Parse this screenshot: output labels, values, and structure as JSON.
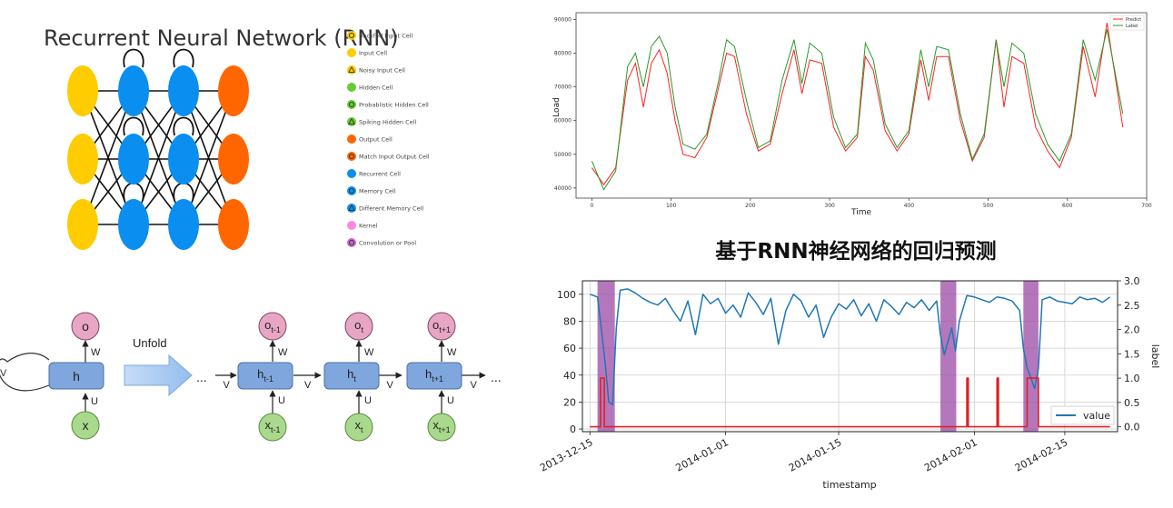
{
  "rnn_panel": {
    "title": "Recurrent Neural Network (RNN)",
    "legend": [
      {
        "label": "Backfed Input Cell",
        "color": "#ffcc00",
        "icon": "ring-dot"
      },
      {
        "label": "Input Cell",
        "color": "#ffcc00",
        "icon": "circle"
      },
      {
        "label": "Noisy Input Cell",
        "color": "#ffcc00",
        "icon": "triangle"
      },
      {
        "label": "Hidden Cell",
        "color": "#66cc33",
        "icon": "circle"
      },
      {
        "label": "Probablistic Hidden Cell",
        "color": "#66cc33",
        "icon": "ring-dot"
      },
      {
        "label": "Spiking Hidden Cell",
        "color": "#66cc33",
        "icon": "triangle"
      },
      {
        "label": "Output Cell",
        "color": "#ff6600",
        "icon": "circle"
      },
      {
        "label": "Match Input Output Cell",
        "color": "#ff6600",
        "icon": "ring-dot"
      },
      {
        "label": "Recurrent Cell",
        "color": "#0a8ef0",
        "icon": "circle"
      },
      {
        "label": "Memory Cell",
        "color": "#0a8ef0",
        "icon": "ring-dot"
      },
      {
        "label": "Different Memory Cell",
        "color": "#0a8ef0",
        "icon": "triangle"
      },
      {
        "label": "Kernel",
        "color": "#ff88dd",
        "icon": "circle"
      },
      {
        "label": "Convolution or Pool",
        "color": "#cc66cc",
        "icon": "ring-dot"
      }
    ],
    "colors": {
      "input": "#ffcc00",
      "recurrent": "#0a8ef0",
      "output": "#ff6600"
    }
  },
  "unfold_panel": {
    "unfold_label": "Unfold",
    "folded": {
      "o": "o",
      "h": "h",
      "x": "x",
      "w": "W",
      "u": "U",
      "v": "V"
    },
    "steps": [
      {
        "o": "o",
        "o_sub": "t-1",
        "h": "h",
        "h_sub": "t-1",
        "x": "x",
        "x_sub": "t-1"
      },
      {
        "o": "o",
        "o_sub": "t",
        "h": "h",
        "h_sub": "t",
        "x": "x",
        "x_sub": "t"
      },
      {
        "o": "o",
        "o_sub": "t+1",
        "h": "h",
        "h_sub": "t+1",
        "x": "x",
        "x_sub": "t+1"
      }
    ],
    "edge_labels": {
      "w": "W",
      "u": "U",
      "v": "V"
    },
    "ellipsis": "...",
    "colors": {
      "o": "#e8a6c4",
      "h": "#7fa7dd",
      "x": "#a9d98c",
      "arrow": "#aac8f2"
    }
  },
  "heading": "基于RNN神经网络的回归预测",
  "chart_data": [
    {
      "type": "line",
      "xlabel": "Time",
      "ylabel": "Load",
      "xlim": [
        -20,
        700
      ],
      "ylim": [
        37000,
        92000
      ],
      "xticks": [
        0,
        100,
        200,
        300,
        400,
        500,
        600,
        700
      ],
      "yticks": [
        40000,
        50000,
        60000,
        70000,
        80000,
        90000
      ],
      "legend_position": "top-right",
      "series": [
        {
          "name": "Predict",
          "color": "#ff2222",
          "x": [
            0,
            15,
            30,
            45,
            55,
            65,
            75,
            85,
            95,
            105,
            115,
            130,
            145,
            160,
            170,
            180,
            195,
            210,
            225,
            240,
            255,
            265,
            275,
            290,
            305,
            320,
            335,
            345,
            355,
            370,
            385,
            400,
            415,
            425,
            435,
            450,
            465,
            480,
            495,
            510,
            520,
            530,
            545,
            560,
            575,
            590,
            605,
            620,
            635,
            650,
            670
          ],
          "y": [
            46000,
            41000,
            46000,
            72000,
            77000,
            64000,
            77000,
            81000,
            74000,
            60000,
            50000,
            49000,
            55000,
            70000,
            80000,
            79000,
            62000,
            51000,
            53000,
            68000,
            81000,
            68000,
            78000,
            77000,
            58000,
            51000,
            55000,
            79000,
            75000,
            57000,
            51000,
            56000,
            78000,
            66000,
            79000,
            79000,
            60000,
            48000,
            55000,
            84000,
            64000,
            79000,
            77000,
            58000,
            51000,
            46000,
            55000,
            82000,
            67000,
            89000,
            58000
          ]
        },
        {
          "name": "Label",
          "color": "#2a9a2a",
          "x": [
            0,
            15,
            30,
            45,
            55,
            65,
            75,
            85,
            95,
            105,
            115,
            130,
            145,
            160,
            170,
            180,
            195,
            210,
            225,
            240,
            255,
            265,
            275,
            290,
            305,
            320,
            335,
            345,
            355,
            370,
            385,
            400,
            415,
            425,
            435,
            450,
            465,
            480,
            495,
            510,
            520,
            530,
            545,
            560,
            575,
            590,
            605,
            620,
            635,
            650,
            670
          ],
          "y": [
            48000,
            39500,
            45000,
            76000,
            80000,
            70000,
            82000,
            85000,
            80000,
            64000,
            53000,
            51500,
            56000,
            72000,
            84000,
            82000,
            66000,
            52000,
            54000,
            72000,
            84000,
            71000,
            83000,
            80000,
            61000,
            52000,
            56000,
            83000,
            78000,
            59000,
            52000,
            57000,
            81000,
            70000,
            82000,
            81000,
            62000,
            48500,
            56000,
            84000,
            70000,
            83000,
            80000,
            62000,
            53000,
            48000,
            56000,
            84000,
            72000,
            87000,
            62000
          ]
        }
      ]
    },
    {
      "type": "line",
      "xlabel": "timestamp",
      "ylabel_right": "label",
      "ylim": [
        -2,
        110
      ],
      "ylim_right": [
        -0.1,
        3.0
      ],
      "yticks": [
        0,
        20,
        40,
        60,
        80,
        100
      ],
      "yticks_right": [
        "0.0",
        "0.5",
        "1.0",
        "1.5",
        "2.0",
        "2.5",
        "3.0"
      ],
      "xlim": [
        -1,
        70
      ],
      "xtick_positions": [
        0,
        18,
        33,
        51,
        63
      ],
      "xtick_labels": [
        "2013-12-15",
        "2014-01-01",
        "2014-01-15",
        "2014-02-01",
        "2014-02-15"
      ],
      "grid": true,
      "legend_position": "bottom-right",
      "anomaly_bands": [
        [
          1,
          3.3
        ],
        [
          46.5,
          48.6
        ],
        [
          57.5,
          59.5
        ]
      ],
      "series": [
        {
          "name": "value",
          "color": "#1f77b4",
          "x": [
            0,
            1,
            1.5,
            2,
            2.5,
            3,
            3.5,
            4,
            5,
            6,
            7,
            8,
            9,
            10,
            11,
            12,
            13,
            14,
            15,
            16,
            17,
            18,
            19,
            20,
            21,
            22,
            23,
            24,
            25,
            26,
            27,
            28,
            29,
            30,
            31,
            32,
            33,
            34,
            35,
            36,
            37,
            38,
            39,
            40,
            41,
            42,
            43,
            44,
            45,
            46,
            46.5,
            47,
            47.5,
            48,
            48.5,
            49,
            50,
            51,
            52,
            53,
            54,
            55,
            56,
            57,
            57.5,
            58,
            58.5,
            59,
            59.5,
            60,
            61,
            62,
            63,
            64,
            65,
            66,
            67,
            68,
            69
          ],
          "y": [
            100,
            98,
            75,
            50,
            20,
            18,
            75,
            103,
            104,
            101,
            97,
            94,
            92,
            97,
            88,
            80,
            95,
            70,
            100,
            93,
            97,
            86,
            92,
            83,
            101,
            94,
            85,
            97,
            63,
            88,
            100,
            95,
            83,
            92,
            68,
            83,
            93,
            89,
            96,
            84,
            93,
            80,
            96,
            91,
            85,
            94,
            90,
            96,
            88,
            95,
            70,
            55,
            65,
            75,
            58,
            80,
            99,
            98,
            96,
            94,
            98,
            97,
            95,
            88,
            60,
            45,
            38,
            30,
            45,
            96,
            98,
            95,
            94,
            93,
            98,
            96,
            97,
            94,
            98
          ]
        },
        {
          "name": "label",
          "color": "#dd2222",
          "axis": "right",
          "x": [
            0,
            1.4,
            1.4,
            1.9,
            1.9,
            50,
            50,
            50.2,
            50.2,
            54,
            54,
            54.2,
            54.2,
            58,
            58,
            59.5,
            59.5,
            69
          ],
          "y": [
            0,
            0,
            1,
            1,
            0,
            0,
            1,
            1,
            0,
            0,
            1,
            1,
            0,
            0,
            1,
            1,
            0,
            0
          ]
        }
      ]
    }
  ]
}
